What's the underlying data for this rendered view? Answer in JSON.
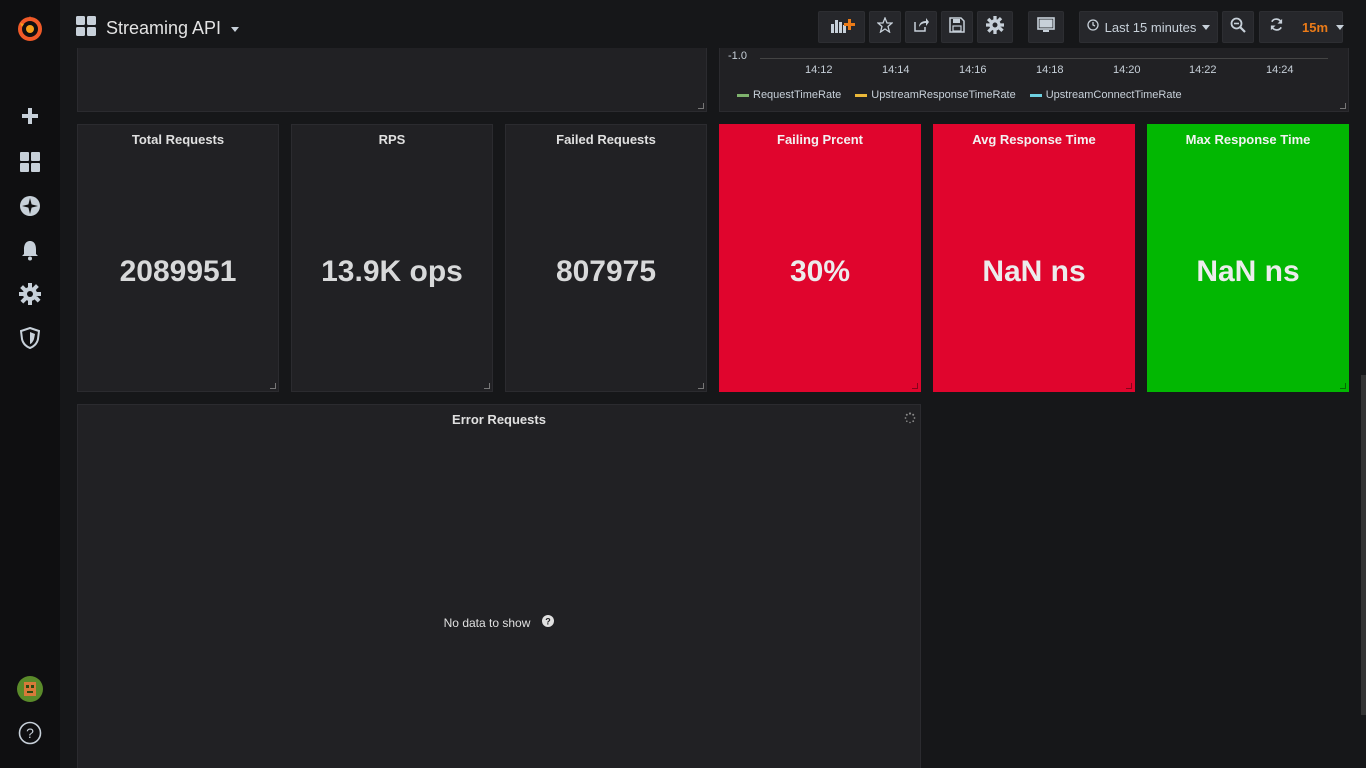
{
  "sidebar": {
    "items": [
      {
        "icon": "grafana-logo-icon"
      },
      {
        "icon": "plus-icon"
      },
      {
        "icon": "dashboards-icon"
      },
      {
        "icon": "explore-icon"
      },
      {
        "icon": "bell-icon"
      },
      {
        "icon": "gear-icon"
      },
      {
        "icon": "shield-icon"
      },
      {
        "icon": "avatar"
      },
      {
        "icon": "help-icon"
      }
    ],
    "help_label": "?"
  },
  "topbar": {
    "dashboard_title": "Streaming API",
    "time_range_label": "Last 15 minutes",
    "refresh_interval": "15m"
  },
  "graph_panel": {
    "y_tick": "-1.0",
    "x_ticks": [
      "14:12",
      "14:14",
      "14:16",
      "14:18",
      "14:20",
      "14:22",
      "14:24"
    ],
    "legend": [
      {
        "name": "RequestTimeRate",
        "color": "#7eb26d"
      },
      {
        "name": "UpstreamResponseTimeRate",
        "color": "#eab839"
      },
      {
        "name": "UpstreamConnectTimeRate",
        "color": "#6ed0e0"
      }
    ]
  },
  "stats": [
    {
      "title": "Total Requests",
      "value": "2089951",
      "style": "default"
    },
    {
      "title": "RPS",
      "value": "13.9K ops",
      "style": "default"
    },
    {
      "title": "Failed Requests",
      "value": "807975",
      "style": "default"
    },
    {
      "title": "Failing Prcent",
      "value": "30%",
      "style": "red"
    },
    {
      "title": "Avg Response Time",
      "value": "NaN ns",
      "style": "red"
    },
    {
      "title": "Max Response Time",
      "value": "NaN ns",
      "style": "green"
    }
  ],
  "error_panel": {
    "title": "Error Requests",
    "empty_text": "No data to show",
    "help_label": "?"
  },
  "colors": {
    "accent": "#eb7b18",
    "red": "#e0052d",
    "green": "#02b702"
  }
}
